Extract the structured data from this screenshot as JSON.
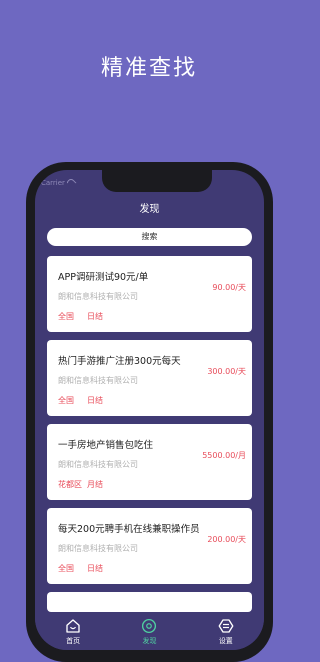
{
  "promo_title": "精准查找",
  "status": {
    "carrier": "Carrier"
  },
  "header": {
    "title": "发现"
  },
  "search": {
    "label": "搜索"
  },
  "jobs": [
    {
      "title": "APP调研测试90元/单",
      "company": "朗和信息科技有限公司",
      "salary": "90.00/天",
      "location": "全国",
      "settlement": "日结"
    },
    {
      "title": "热门手游推广注册300元每天",
      "company": "朗和信息科技有限公司",
      "salary": "300.00/天",
      "location": "全国",
      "settlement": "日结"
    },
    {
      "title": "一手房地产销售包吃住",
      "company": "朗和信息科技有限公司",
      "salary": "5500.00/月",
      "location": "花都区",
      "settlement": "月结"
    },
    {
      "title": "每天200元聘手机在线兼职操作员",
      "company": "朗和信息科技有限公司",
      "salary": "200.00/天",
      "location": "全国",
      "settlement": "日结"
    }
  ],
  "tabbar": {
    "items": [
      {
        "label": "首页",
        "icon": "home-icon"
      },
      {
        "label": "发现",
        "icon": "discover-icon",
        "active": true
      },
      {
        "label": "设置",
        "icon": "settings-icon"
      }
    ]
  },
  "colors": {
    "background": "#6e68c1",
    "screen": "#403a74",
    "accent": "#e84c5a",
    "active_tab": "#4fd0a0"
  }
}
